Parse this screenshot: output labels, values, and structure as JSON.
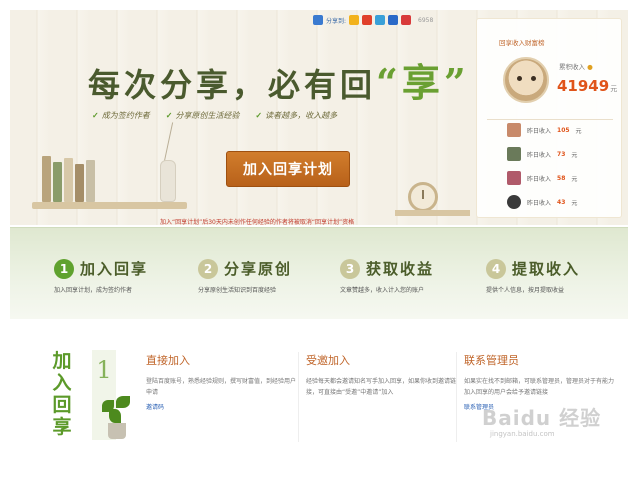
{
  "share": {
    "label": "分享到:",
    "count": "6958",
    "icons": [
      "qzone-icon",
      "sina-weibo-icon",
      "tencent-weibo-icon",
      "renren-icon",
      "douban-icon"
    ]
  },
  "hero": {
    "slogan_main": "每次分享，必有回",
    "slogan_quote": "“享”",
    "features": [
      "成为签约作者",
      "分享原创生活经验",
      "读者越多，收入越多"
    ],
    "join_button": "加入回享计划",
    "notice": "加入“回享计划”后30天内未创作任何经验的作者将被取消“回享计划”资格"
  },
  "rank": {
    "title": "回享收入财富榜",
    "cumulative_label": "累积收入",
    "cumulative_value": "41949",
    "cumulative_unit": "元",
    "rows": [
      {
        "label": "昨日收入",
        "amount": "105",
        "unit": "元"
      },
      {
        "label": "昨日收入",
        "amount": "73",
        "unit": "元"
      },
      {
        "label": "昨日收入",
        "amount": "58",
        "unit": "元"
      },
      {
        "label": "昨日收入",
        "amount": "43",
        "unit": "元"
      }
    ]
  },
  "steps": [
    {
      "num": "1",
      "title": "加入回享",
      "desc": "加入回享计划，成为签约作者"
    },
    {
      "num": "2",
      "title": "分享原创",
      "desc": "分享原创生活知识到百度经验"
    },
    {
      "num": "3",
      "title": "获取收益",
      "desc": "文章赞越多，收入计入您的账户"
    },
    {
      "num": "4",
      "title": "提取收入",
      "desc": "提供个人信息，按月提取收益"
    }
  ],
  "join_section": {
    "vertical_title": "加入回享",
    "number": "1",
    "columns": [
      {
        "title": "直接加入",
        "body": "登陆百度账号，熟悉经验规则，撰写财富值，到经验用户申请",
        "link": "邀请码"
      },
      {
        "title": "受邀加入",
        "body": "经验每天都会邀请知名写手加入回享，如果你收到邀请链接，可直接由“受邀”中邀请”加入",
        "link": ""
      },
      {
        "title": "联系管理员",
        "body": "如果实在找不到邮箱，可联系管理员，管理员对于有能力加入回享的用户会给予邀请链接",
        "link": "联系管理员"
      }
    ]
  },
  "watermark": {
    "main": "Baidu 经验",
    "sub": "jingyan.baidu.com"
  },
  "colors": {
    "accent_orange": "#c0652a",
    "button_orange": "#c06f22",
    "step_green": "#6aa032",
    "amount_red": "#e0541a"
  }
}
